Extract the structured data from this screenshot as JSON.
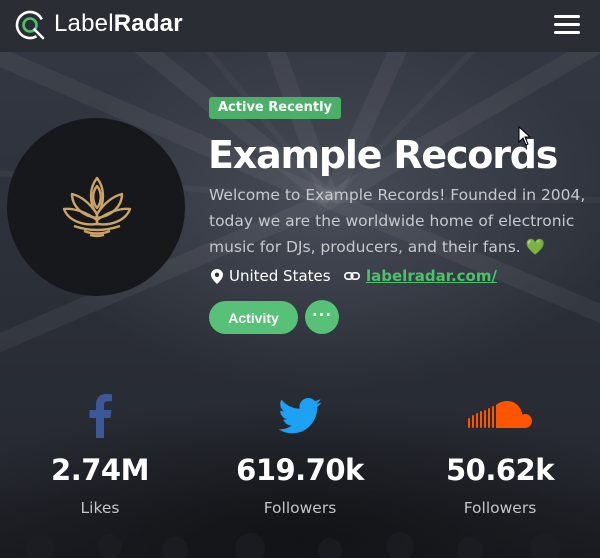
{
  "header": {
    "brand_light": "Label",
    "brand_bold": "Radar",
    "menu_icon": "hamburger-menu-icon"
  },
  "profile": {
    "status_badge": "Active Recently",
    "name": "Example Records",
    "description": "Welcome to Example Records! Founded in 2004, today we are the worldwide home of electronic music for DJs, producers, and their fans.",
    "description_emoji": "💚",
    "location": "United States",
    "website": "labelradar.com/",
    "activity_button": "Activity",
    "more_button": "···"
  },
  "stats": [
    {
      "icon": "facebook-icon",
      "value": "2.74M",
      "label": "Likes"
    },
    {
      "icon": "twitter-icon",
      "value": "619.70k",
      "label": "Followers"
    },
    {
      "icon": "soundcloud-icon",
      "value": "50.62k",
      "label": "Followers"
    }
  ],
  "colors": {
    "accent_green": "#56c177",
    "badge_green": "#4caf68",
    "facebook_blue": "#3b5998",
    "twitter_blue": "#1da1f2",
    "soundcloud_orange": "#ff5500",
    "lotus_gold": "#c9a36a"
  }
}
